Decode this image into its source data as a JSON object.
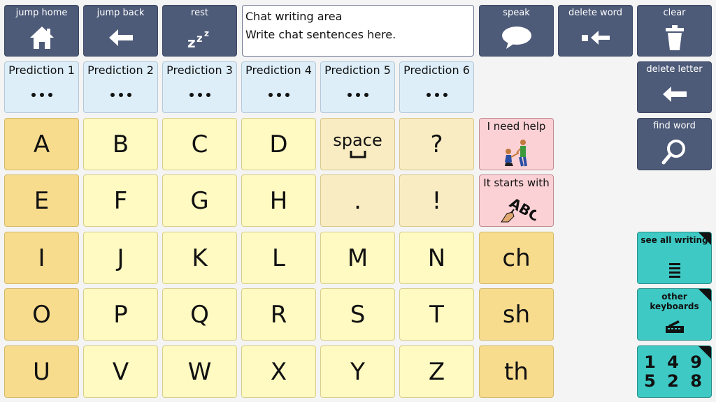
{
  "top_bar": {
    "jump_home": "jump home",
    "jump_back": "jump back",
    "rest": "rest",
    "speak": "speak",
    "delete_word": "delete word",
    "clear": "clear"
  },
  "chat": {
    "title": "Chat writing area",
    "text": "Write chat sentences here."
  },
  "predictions": [
    "Prediction 1",
    "Prediction 2",
    "Prediction 3",
    "Prediction 4",
    "Prediction 5",
    "Prediction 6"
  ],
  "side": {
    "delete_letter": "delete letter",
    "find_word": "find word",
    "see_all_writing": "see all writing",
    "other_keyboards": "other keyboards",
    "numbers_line1": "1 4 9",
    "numbers_line2": "5 2 8"
  },
  "keys": {
    "row1": [
      "A",
      "B",
      "C",
      "D",
      "space",
      "?"
    ],
    "row2": [
      "E",
      "F",
      "G",
      "H",
      ".",
      "!"
    ],
    "row3": [
      "I",
      "J",
      "K",
      "L",
      "M",
      "N",
      "ch"
    ],
    "row4": [
      "O",
      "P",
      "Q",
      "R",
      "S",
      "T",
      "sh"
    ],
    "row5": [
      "U",
      "V",
      "W",
      "X",
      "Y",
      "Z",
      "th"
    ]
  },
  "phrases": {
    "need_help": "I need help",
    "starts_with": "It starts with"
  },
  "icons": {
    "jump_home": "house-icon",
    "jump_back": "arrow-left-icon",
    "rest": "zzz-icon",
    "speak": "speech-bubble-icon",
    "delete_word": "delete-word-icon",
    "clear": "trash-icon",
    "delete_letter": "arrow-left-icon",
    "find_word": "magnifier-icon",
    "see_all_writing": "lines-icon",
    "other_keyboards": "keyboard-icon"
  },
  "colors": {
    "dark_button": "#4d5a78",
    "prediction": "#ddeef9",
    "letter_light": "#fff9c2",
    "letter_dark": "#f7dc8e",
    "phrase": "#fbd1d5",
    "teal": "#3ec9c4"
  }
}
